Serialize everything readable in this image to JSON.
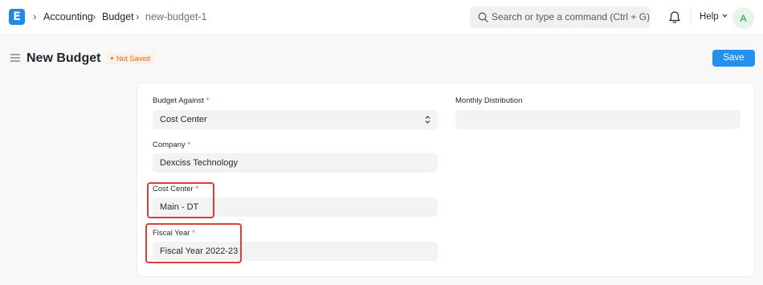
{
  "navbar": {
    "logo_letter": "E",
    "breadcrumbs": [
      {
        "label": "Accounting"
      },
      {
        "label": "Budget"
      },
      {
        "label": "new-budget-1"
      }
    ],
    "search_placeholder": "Search or type a command (Ctrl + G)",
    "help_label": "Help",
    "avatar_initial": "A"
  },
  "page": {
    "title": "New Budget",
    "status": "Not Saved",
    "save_label": "Save"
  },
  "form": {
    "budget_against": {
      "label": "Budget Against",
      "value": "Cost Center",
      "required": "*"
    },
    "monthly_distribution": {
      "label": "Monthly Distribution",
      "value": ""
    },
    "company": {
      "label": "Company",
      "value": "Dexciss Technology",
      "required": "*"
    },
    "cost_center": {
      "label": "Cost Center",
      "value": "Main - DT",
      "required": "*"
    },
    "fiscal_year": {
      "label": "Fiscal Year",
      "value": "Fiscal Year 2022-23",
      "required": "*"
    }
  },
  "colors": {
    "primary": "#2490ef",
    "logo": "#1f8ae8",
    "not_saved": "#e86c13",
    "highlight": "#e03c3c",
    "required": "#e24c4c"
  },
  "icons": [
    "app-logo-icon",
    "chevron-right-icon",
    "search-icon",
    "bell-icon",
    "chevron-down-icon",
    "hamburger-icon",
    "select-arrows-icon"
  ]
}
